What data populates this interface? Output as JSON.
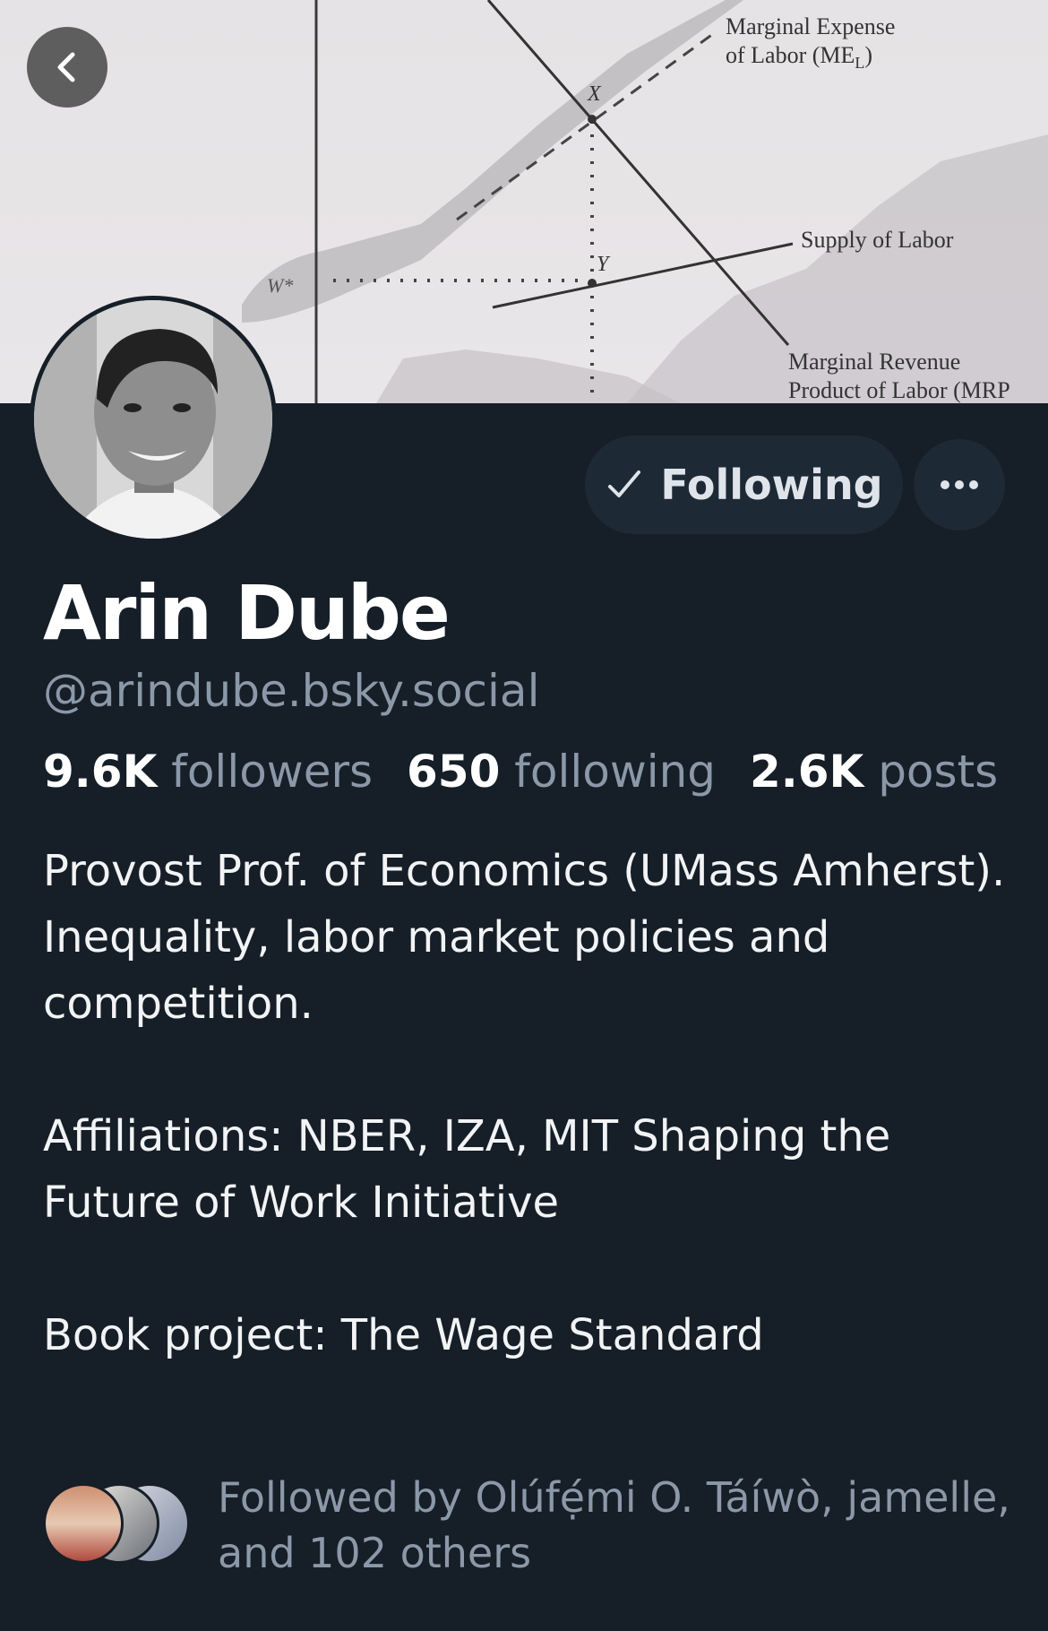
{
  "banner": {
    "labels": {
      "marginal_expense": "Marginal Expense",
      "of_labor": "of Labor (ME",
      "subscript": "L",
      "close_paren": ")",
      "supply": "Supply of Labor",
      "mrp_line1": "Marginal Revenue",
      "mrp_line2": "Product of Labor (MRP",
      "x_point": "X",
      "y_point": "Y",
      "w_star": "W*"
    }
  },
  "header": {
    "back_icon": "chevron-left-icon"
  },
  "actions": {
    "following_label": "Following",
    "check_icon": "check-icon",
    "more_icon": "ellipsis-icon"
  },
  "profile": {
    "display_name": "Arin Dube",
    "handle": "@arindube.bsky.social",
    "stats": {
      "followers_count": "9.6K",
      "followers_label": "followers",
      "following_count": "650",
      "following_label": "following",
      "posts_count": "2.6K",
      "posts_label": "posts"
    },
    "bio": {
      "line1": "Provost Prof. of Economics (UMass Amherst).",
      "line2": "Inequality, labor market policies and competition.",
      "line3": "Affiliations: NBER, IZA, MIT Shaping the Future of Work Initiative",
      "line4": "Book project: The Wage Standard"
    },
    "followed_by": "Followed by Olúfẹ́mi O. Táíwò, jamelle, and 102 others"
  },
  "colors": {
    "background": "#161e27",
    "button_bg": "#1e2936",
    "muted_text": "#8b98a8"
  }
}
